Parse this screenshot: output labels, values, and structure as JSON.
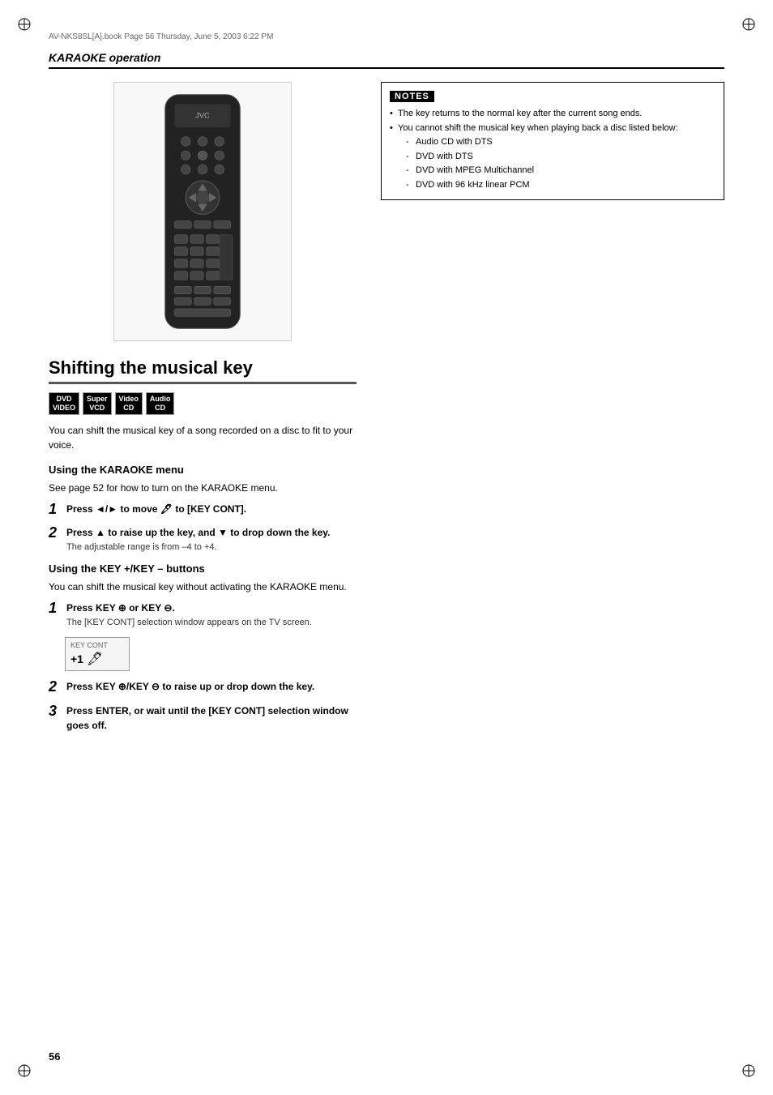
{
  "page": {
    "number": "56",
    "file_path": "AV-NKS8SL[A].book  Page 56  Thursday, June 5, 2003  6:22 PM"
  },
  "header": {
    "title": "KARAOKE operation"
  },
  "section": {
    "title": "Shifting the musical key",
    "intro": "You can shift the musical key of a song recorded on a disc to fit to your voice.",
    "badges": [
      {
        "label": "DVD\nVIDEO",
        "type": "dvd"
      },
      {
        "label": "Super\nVCD",
        "type": "super"
      },
      {
        "label": "Video\nCD",
        "type": "video"
      },
      {
        "label": "Audio\nCD",
        "type": "audio"
      }
    ]
  },
  "karaoke_menu": {
    "title": "Using the KARAOKE menu",
    "see_page": "See page 52 for how to turn on the KARAOKE menu.",
    "steps": [
      {
        "num": "1",
        "text": "Press ◄/► to move  to [KEY CONT]."
      },
      {
        "num": "2",
        "text": "Press ▲ to raise up the key, and ▼ to drop down the key.",
        "sub": "The adjustable range is from –4 to +4."
      }
    ]
  },
  "key_buttons": {
    "title": "Using the KEY +/KEY – buttons",
    "intro": "You can shift the musical key without activating the KARAOKE menu.",
    "steps": [
      {
        "num": "1",
        "text": "Press KEY + or KEY –.",
        "sub": "The [KEY CONT] selection window appears on the TV screen."
      },
      {
        "num": "2",
        "text": "Press KEY +/KEY – to raise up or drop down the key."
      },
      {
        "num": "3",
        "text": "Press ENTER, or wait until the [KEY CONT] selection window goes off."
      }
    ],
    "keycont_label": "KEY CONT",
    "keycont_value": "+1"
  },
  "notes": {
    "header": "NOTES",
    "items": [
      "The key returns to the normal key after the current song ends.",
      "You cannot shift the musical key when playing back a disc listed below:"
    ],
    "subitems": [
      "Audio CD with DTS",
      "DVD with DTS",
      "DVD with MPEG Multichannel",
      "DVD with 96 kHz linear PCM"
    ]
  }
}
